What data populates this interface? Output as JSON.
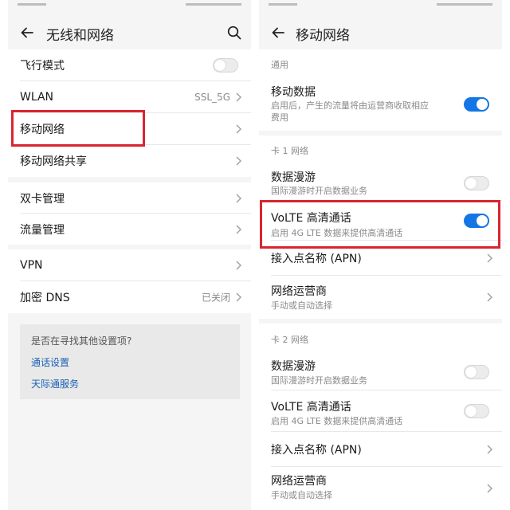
{
  "left": {
    "title": "无线和网络",
    "rows": [
      {
        "label": "飞行模式"
      },
      {
        "label": "WLAN",
        "value": "SSL_5G"
      },
      {
        "label": "移动网络"
      },
      {
        "label": "移动网络共享"
      },
      {
        "label": "双卡管理"
      },
      {
        "label": "流量管理"
      },
      {
        "label": "VPN"
      },
      {
        "label": "加密 DNS",
        "value": "已关闭"
      }
    ],
    "toggles": {
      "airplane_on": false
    },
    "suggest": {
      "question": "是否在寻找其他设置项?",
      "links": [
        "通话设置",
        "天际通服务"
      ]
    }
  },
  "right": {
    "title": "移动网络",
    "sections": [
      {
        "header": "通用",
        "rows": [
          {
            "label": "移动数据",
            "desc": "启用后，产生的流量将由运营商收取相应",
            "desc2": "费用",
            "on": true
          }
        ]
      },
      {
        "header": "卡 1 网络",
        "rows": [
          {
            "label": "数据漫游",
            "desc": "国际漫游时开启数据业务",
            "on": false
          },
          {
            "label": "VoLTE 高清通话",
            "desc": "启用 4G LTE 数据来提供高清通话",
            "on": true
          },
          {
            "label": "接入点名称 (APN)"
          },
          {
            "label": "网络运营商",
            "desc": "手动或自动选择"
          }
        ]
      },
      {
        "header": "卡 2 网络",
        "rows": [
          {
            "label": "数据漫游",
            "desc": "国际漫游时开启数据业务",
            "on": false
          },
          {
            "label": "VoLTE 高清通话",
            "desc": "启用 4G LTE 数据来提供高清通话",
            "on": false
          },
          {
            "label": "接入点名称 (APN)"
          },
          {
            "label": "网络运营商",
            "desc": "手动或自动选择"
          }
        ]
      }
    ]
  },
  "colors": {
    "accent": "#1476e4",
    "highlight": "#d92531",
    "link": "#1a5fb4"
  }
}
